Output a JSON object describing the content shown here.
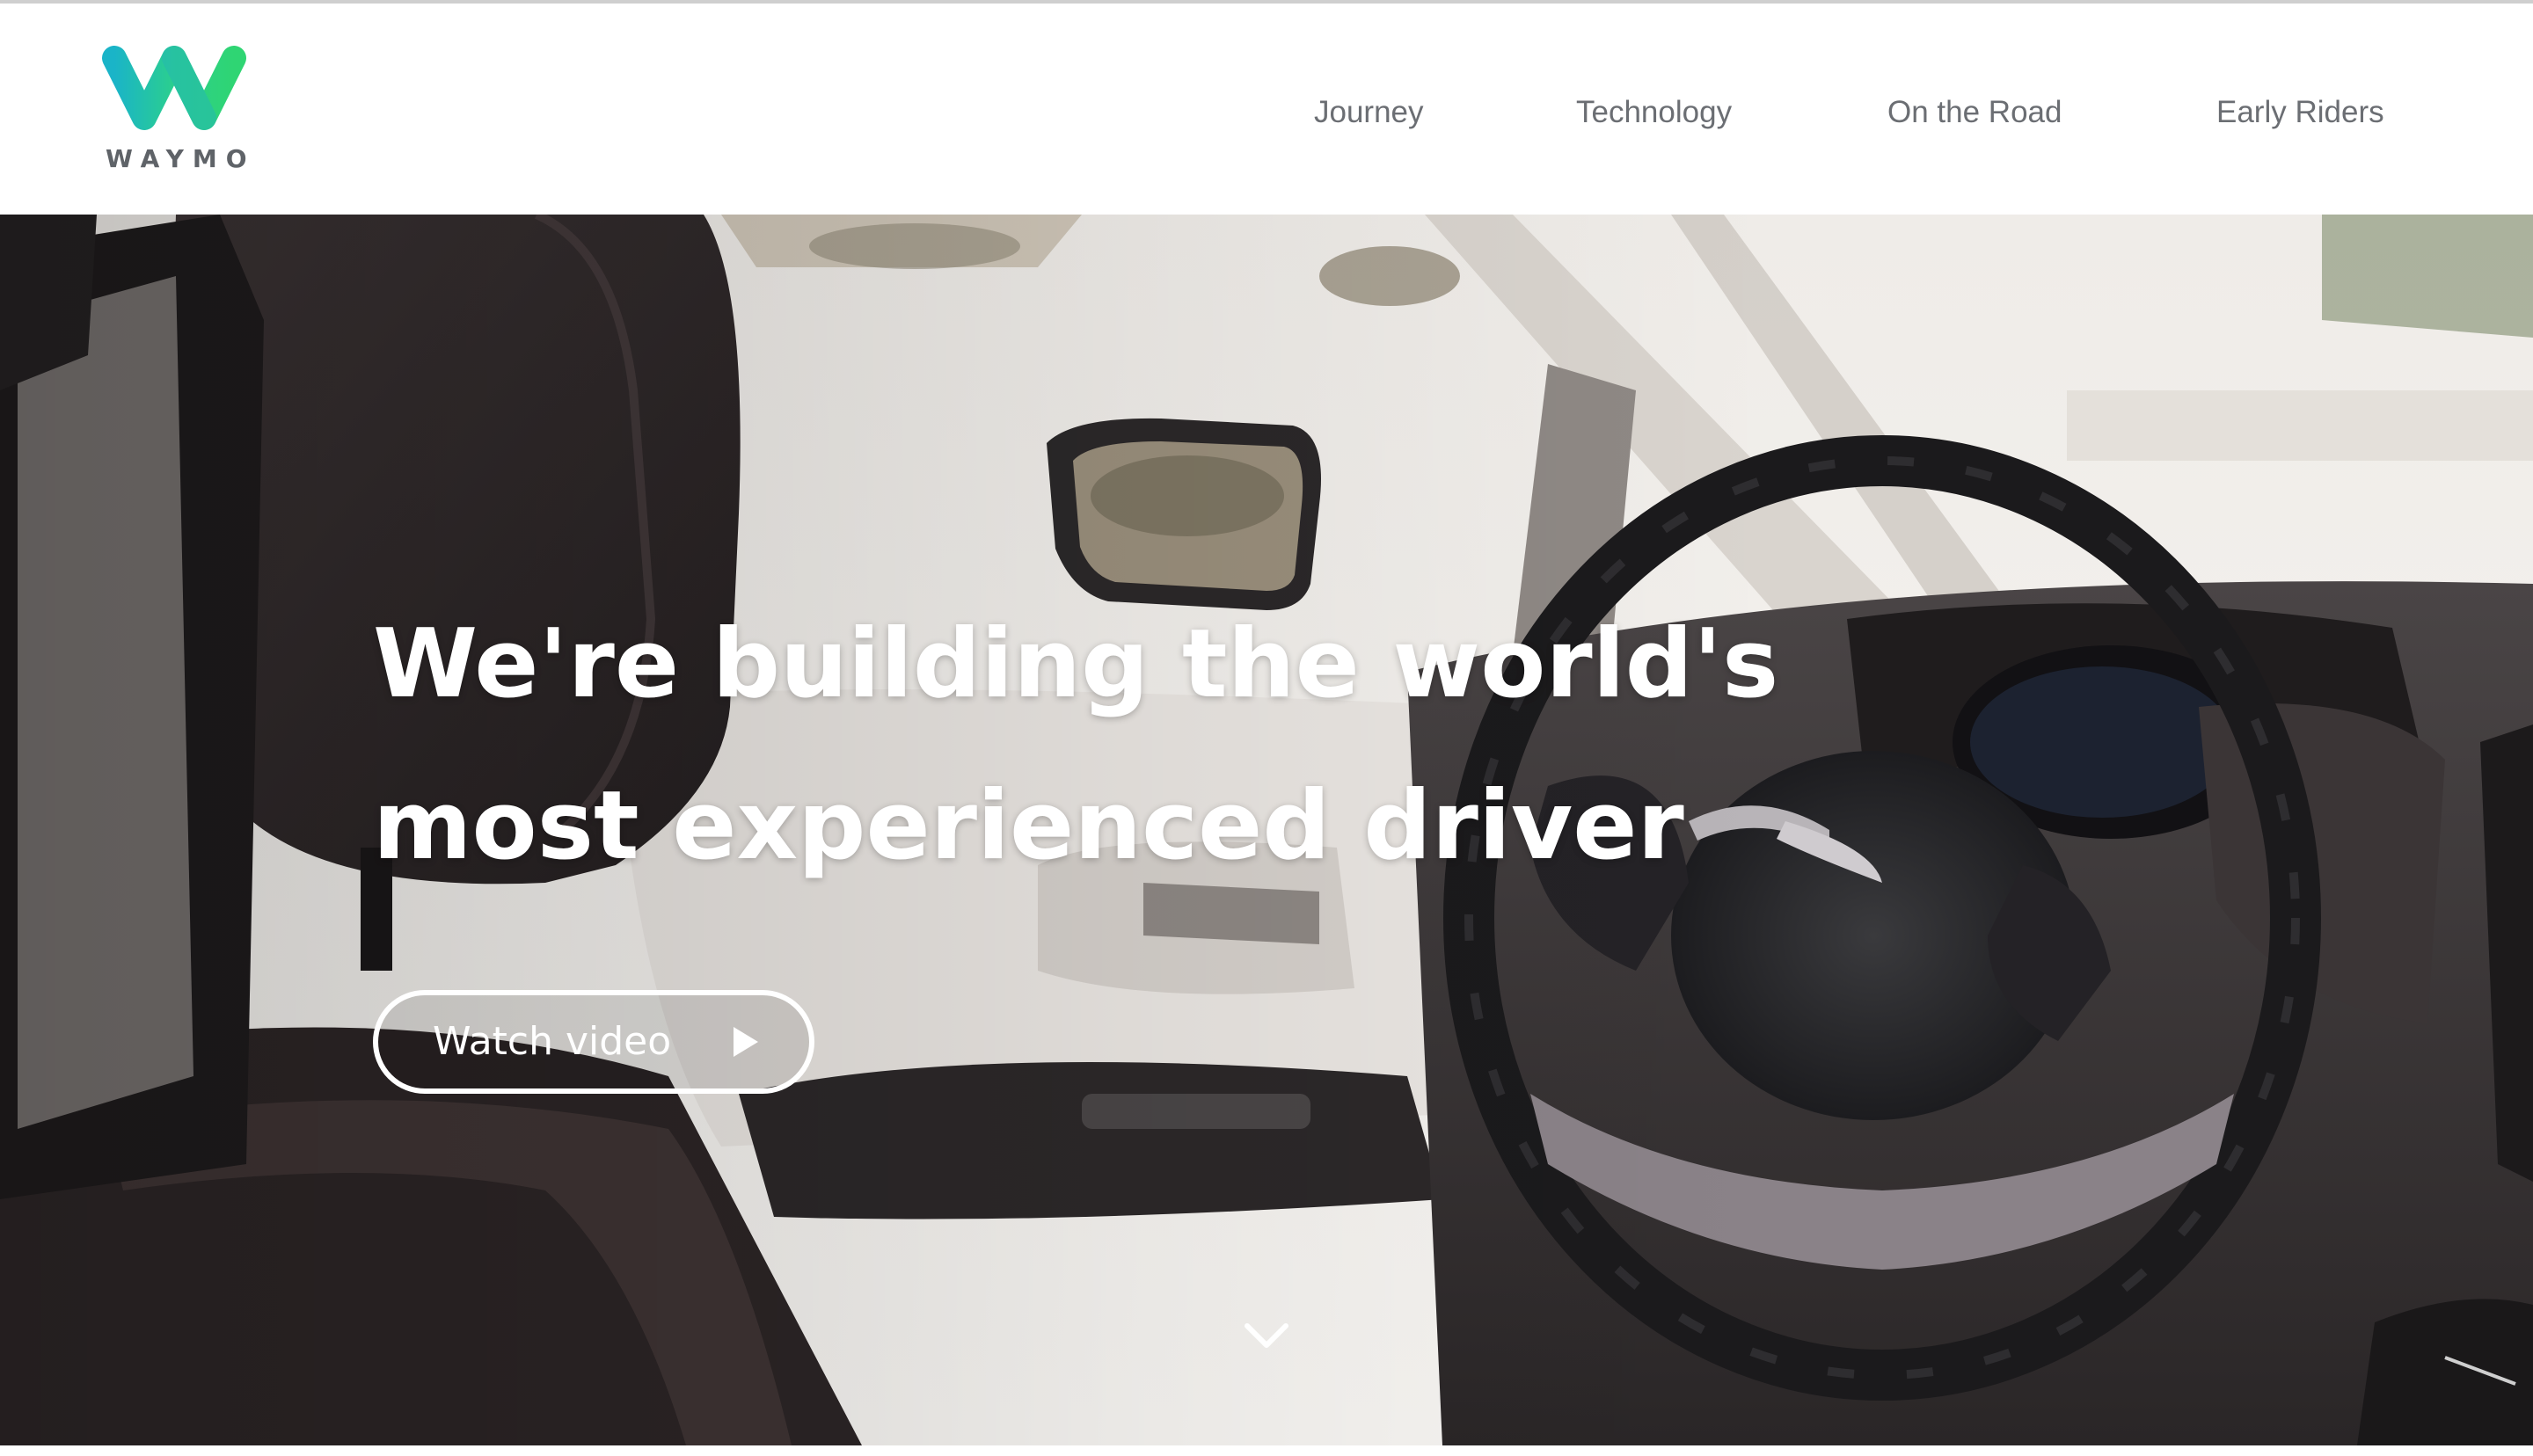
{
  "brand": {
    "wordmark": "WAYMO",
    "logo_icon": "waymo-w-logo",
    "colors": {
      "logo_teal": "#1ab4c8",
      "logo_green": "#2fd573",
      "wordmark_gray": "#5f6368",
      "nav_text": "#6b6e73"
    }
  },
  "nav": {
    "items": [
      {
        "label": "Journey"
      },
      {
        "label": "Technology"
      },
      {
        "label": "On the Road"
      },
      {
        "label": "Early Riders"
      }
    ]
  },
  "hero": {
    "headline_line1": "We're building the world's",
    "headline_line2": "most experienced driver",
    "cta_label": "Watch video",
    "cta_icon": "play-icon",
    "scroll_icon": "chevron-down-icon",
    "background_image": "car-interior-steering-wheel"
  }
}
